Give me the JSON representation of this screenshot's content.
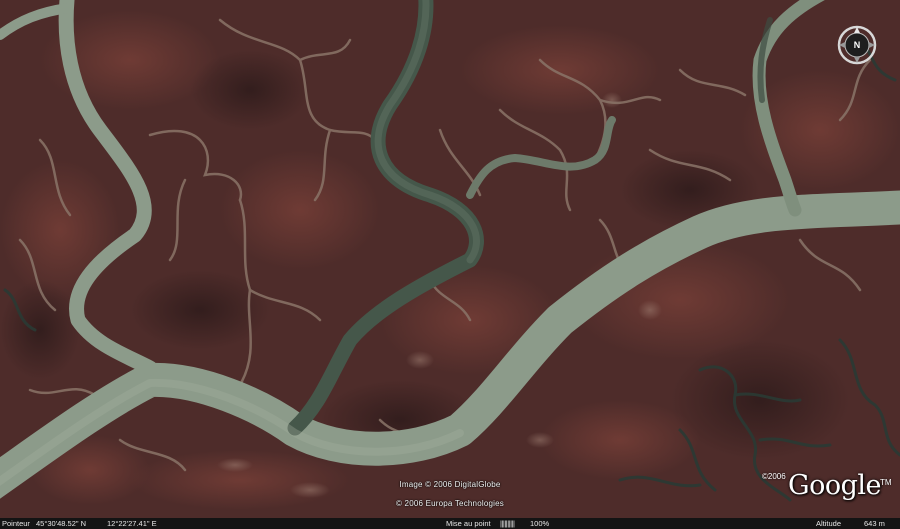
{
  "map": {
    "credits": {
      "imagery": "Image © 2006 DigitalGlobe",
      "data": "© 2006 Europa Technologies"
    },
    "logo": {
      "copyright": "©2006",
      "wordmark": "Google",
      "trademark": "TM"
    },
    "compass": {
      "north_label": "N",
      "icon": "compass-icon"
    },
    "colors": {
      "marsh": "#4e2c2a",
      "channel": "#8c9b8a",
      "channel_dark": "#3c4a40",
      "mudflat": "#8e7a6e",
      "statusbar": "#141414"
    }
  },
  "statusbar": {
    "pointer_label": "Pointeur",
    "latitude": "45°30'48.52\"  N",
    "longitude": "12°22'27.41\"   E",
    "streaming_label": "Mise au point",
    "streaming_bar": "||||||||||",
    "streaming_percent": "100%",
    "altitude_label": "Altitude",
    "altitude_value": "643 m"
  }
}
